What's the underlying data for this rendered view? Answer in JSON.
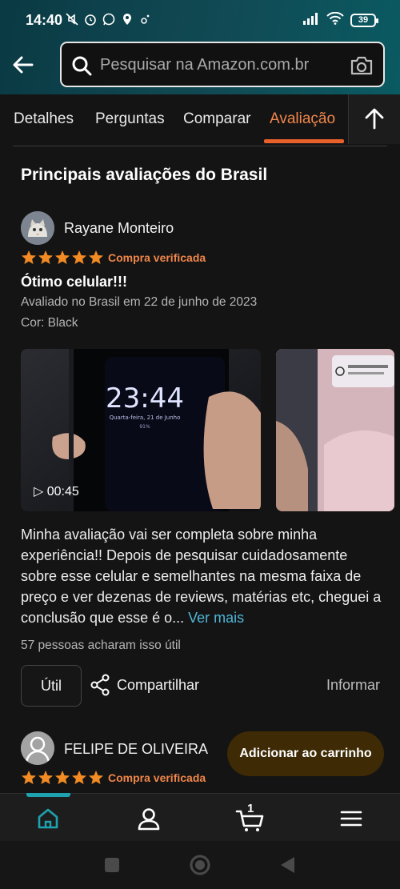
{
  "status_bar": {
    "time": "14:40",
    "battery": "39"
  },
  "search": {
    "placeholder": "Pesquisar na Amazon.com.br"
  },
  "tabs": [
    {
      "label": "Detalhes"
    },
    {
      "label": "Perguntas"
    },
    {
      "label": "Comparar"
    },
    {
      "label": "Avaliação",
      "active": true
    }
  ],
  "section": {
    "title": "Principais avaliações do Brasil"
  },
  "review": {
    "reviewer": "Rayane Monteiro",
    "rating": 5,
    "verified": "Compra verificada",
    "title": "Ótimo celular!!!",
    "date_line": "Avaliado no Brasil em 22 de junho de 2023",
    "color_line": "Cor: Black",
    "video_duration": "00:45",
    "body": "Minha avaliação vai ser completa sobre minha experiência!! Depois de pesquisar cuidadosamente sobre esse celular e semelhantes na mesma faixa de preço e ver dezenas de reviews, matérias etc, cheguei a conclusão que esse é o...",
    "see_more": "Ver mais",
    "helpful": "57 pessoas acharam isso útil",
    "btn_util": "Útil",
    "btn_share": "Compartilhar",
    "btn_report": "Informar"
  },
  "review2": {
    "reviewer": "FELIPE DE OLIVEIRA",
    "rating": 5,
    "verified": "Compra verificada"
  },
  "cart_cta": "Adicionar ao carrinho",
  "bottom_nav": {
    "cart_count": "1"
  },
  "colors": {
    "accent": "#f0864a",
    "tab_underline": "#e8602a",
    "link": "#4fb6d8",
    "star": "#f28b23"
  }
}
